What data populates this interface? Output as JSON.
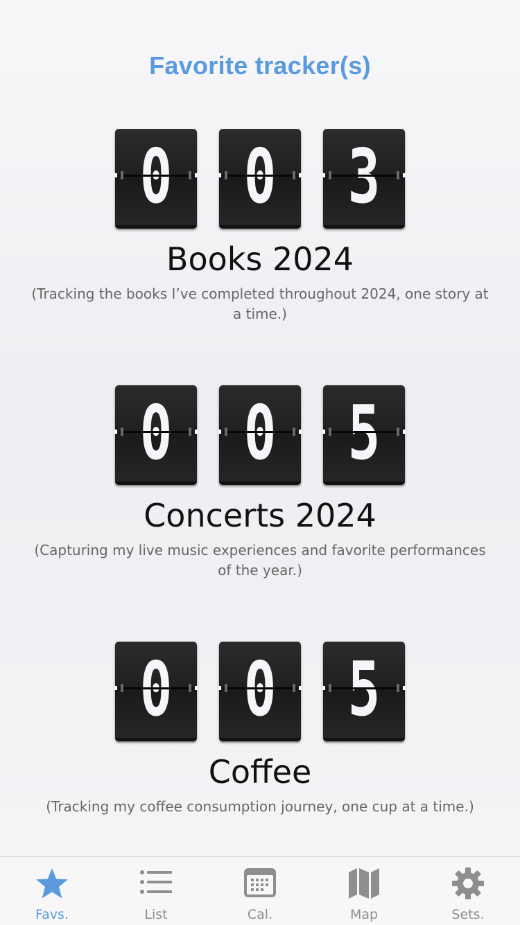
{
  "header": {
    "title": "Favorite tracker(s)"
  },
  "colors": {
    "accent": "#5b9bdd",
    "inactive": "#8e8e8e",
    "card": "#222222"
  },
  "trackers": [
    {
      "digits": [
        "0",
        "0",
        "3"
      ],
      "name": "Books 2024",
      "description": "(Tracking the books I’ve completed throughout 2024, one story at a time.)"
    },
    {
      "digits": [
        "0",
        "0",
        "5"
      ],
      "name": "Concerts 2024",
      "description": "(Capturing my live music experiences and favorite performances of the year.)"
    },
    {
      "digits": [
        "0",
        "0",
        "5"
      ],
      "name": "Coffee",
      "description": "(Tracking my coffee consumption journey, one cup at a time.)"
    }
  ],
  "tab_bar": {
    "tabs": [
      {
        "label": "Favs.",
        "icon": "star-icon",
        "active": true
      },
      {
        "label": "List",
        "icon": "list-icon",
        "active": false
      },
      {
        "label": "Cal.",
        "icon": "calendar-icon",
        "active": false
      },
      {
        "label": "Map",
        "icon": "map-icon",
        "active": false
      },
      {
        "label": "Sets.",
        "icon": "gear-icon",
        "active": false
      }
    ]
  }
}
